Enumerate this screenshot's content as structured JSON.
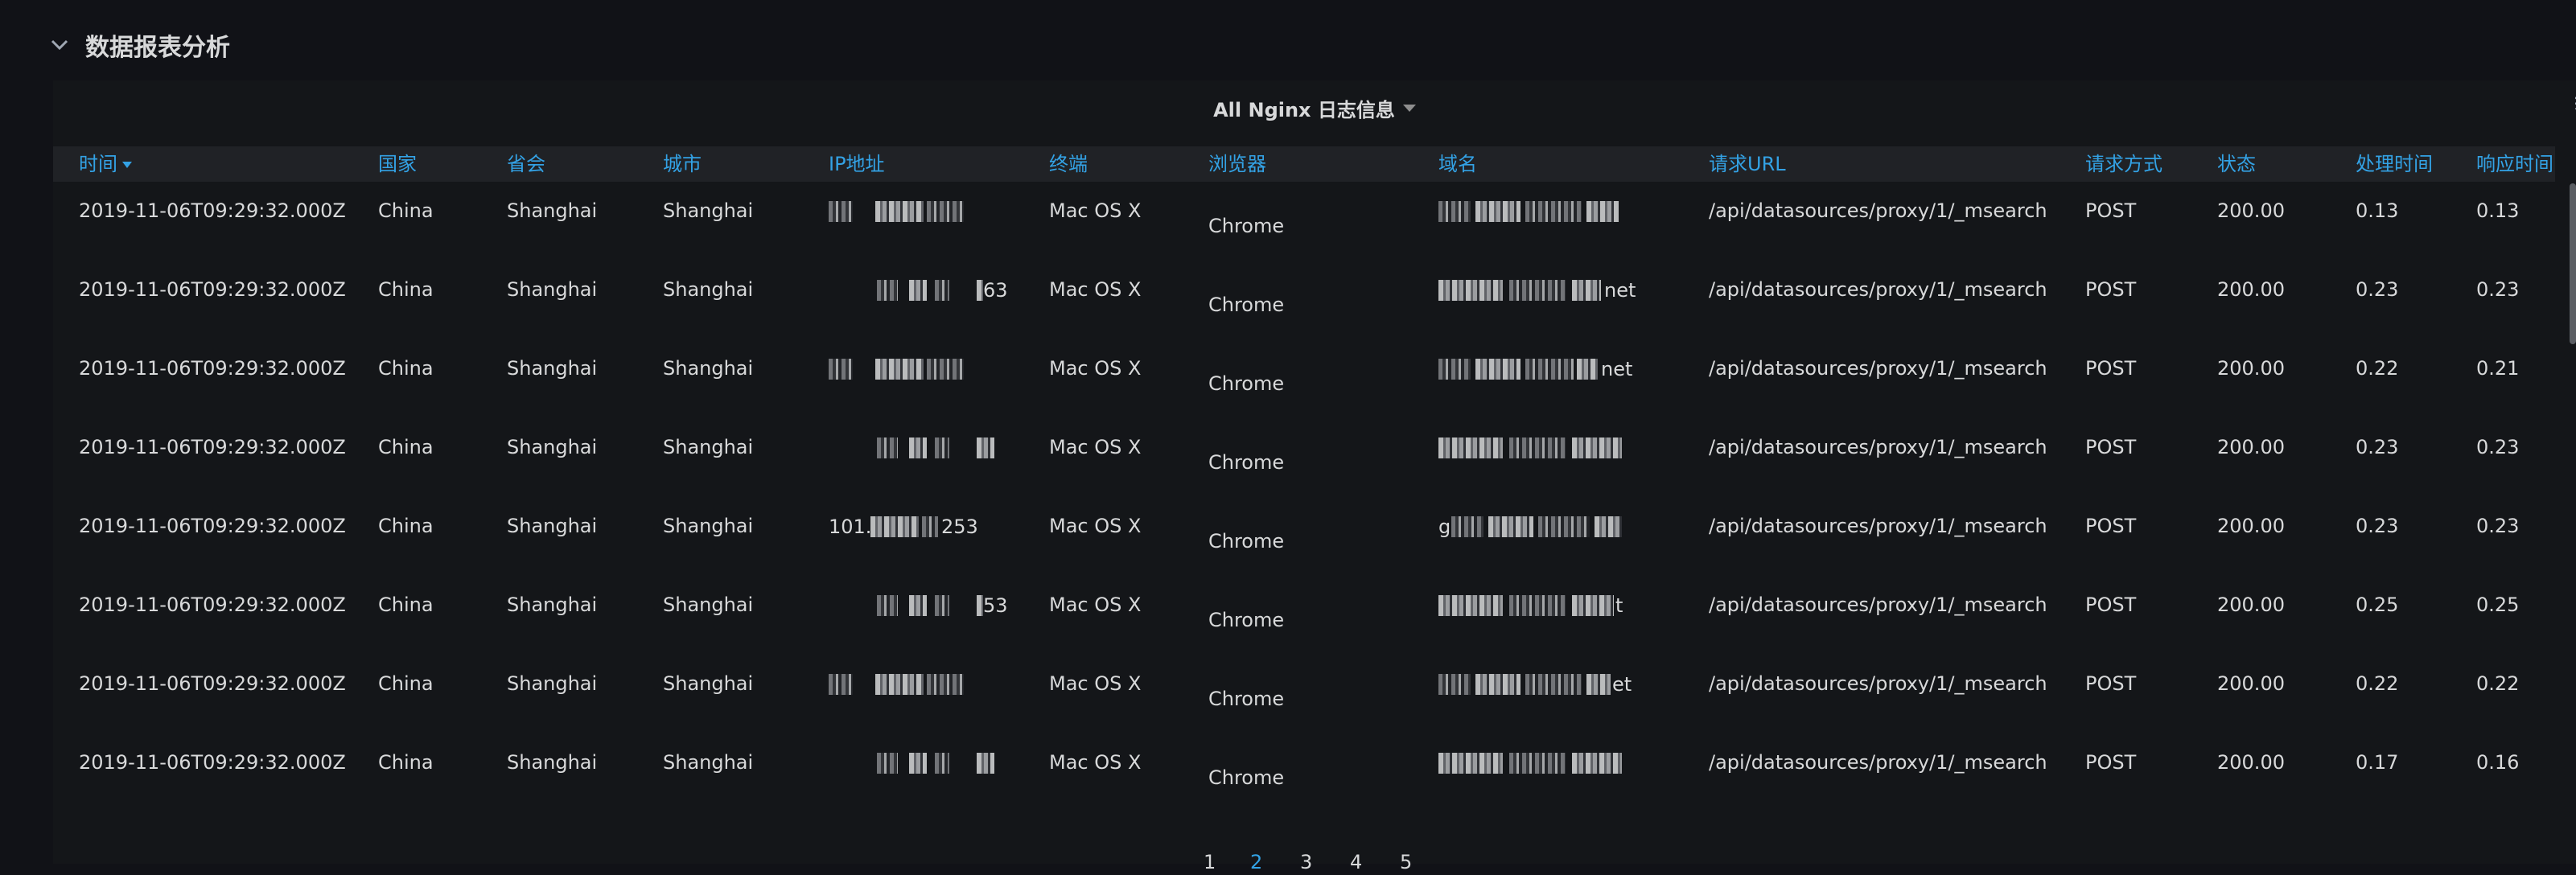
{
  "row": {
    "title": "数据报表分析"
  },
  "panel": {
    "title": "All Nginx 日志信息"
  },
  "columns": [
    "时间",
    "国家",
    "省会",
    "城市",
    "IP地址",
    "终端",
    "浏览器",
    "域名",
    "请求URL",
    "请求方式",
    "状态",
    "处理时间",
    "响应时间"
  ],
  "rows": [
    {
      "time": "2019-11-06T09:29:32.000Z",
      "country": "China",
      "province": "Shanghai",
      "city": "Shanghai",
      "ip_visible": "",
      "os": "Mac OS X",
      "browser": "Chrome",
      "domain_visible": "",
      "url": "/api/datasources/proxy/1/_msearch",
      "method": "POST",
      "status": "200.00",
      "process_time": "0.13",
      "response_time": "0.13"
    },
    {
      "time": "2019-11-06T09:29:32.000Z",
      "country": "China",
      "province": "Shanghai",
      "city": "Shanghai",
      "ip_visible": "63",
      "os": "Mac OS X",
      "browser": "Chrome",
      "domain_visible": "net",
      "url": "/api/datasources/proxy/1/_msearch",
      "method": "POST",
      "status": "200.00",
      "process_time": "0.23",
      "response_time": "0.23"
    },
    {
      "time": "2019-11-06T09:29:32.000Z",
      "country": "China",
      "province": "Shanghai",
      "city": "Shanghai",
      "ip_visible": "",
      "os": "Mac OS X",
      "browser": "Chrome",
      "domain_visible": "net",
      "url": "/api/datasources/proxy/1/_msearch",
      "method": "POST",
      "status": "200.00",
      "process_time": "0.22",
      "response_time": "0.21"
    },
    {
      "time": "2019-11-06T09:29:32.000Z",
      "country": "China",
      "province": "Shanghai",
      "city": "Shanghai",
      "ip_visible": "",
      "os": "Mac OS X",
      "browser": "Chrome",
      "domain_visible": "",
      "url": "/api/datasources/proxy/1/_msearch",
      "method": "POST",
      "status": "200.00",
      "process_time": "0.23",
      "response_time": "0.23"
    },
    {
      "time": "2019-11-06T09:29:32.000Z",
      "country": "China",
      "province": "Shanghai",
      "city": "Shanghai",
      "ip_visible": "101.",
      "ip_visible_end": "253",
      "os": "Mac OS X",
      "browser": "Chrome",
      "domain_visible": "g",
      "url": "/api/datasources/proxy/1/_msearch",
      "method": "POST",
      "status": "200.00",
      "process_time": "0.23",
      "response_time": "0.23"
    },
    {
      "time": "2019-11-06T09:29:32.000Z",
      "country": "China",
      "province": "Shanghai",
      "city": "Shanghai",
      "ip_visible": "53",
      "os": "Mac OS X",
      "browser": "Chrome",
      "domain_visible": "t",
      "url": "/api/datasources/proxy/1/_msearch",
      "method": "POST",
      "status": "200.00",
      "process_time": "0.25",
      "response_time": "0.25"
    },
    {
      "time": "2019-11-06T09:29:32.000Z",
      "country": "China",
      "province": "Shanghai",
      "city": "Shanghai",
      "ip_visible": "",
      "os": "Mac OS X",
      "browser": "Chrome",
      "domain_visible": "et",
      "url": "/api/datasources/proxy/1/_msearch",
      "method": "POST",
      "status": "200.00",
      "process_time": "0.22",
      "response_time": "0.22"
    },
    {
      "time": "2019-11-06T09:29:32.000Z",
      "country": "China",
      "province": "Shanghai",
      "city": "Shanghai",
      "ip_visible": "",
      "os": "Mac OS X",
      "browser": "Chrome",
      "domain_visible": "",
      "url": "/api/datasources/proxy/1/_msearch",
      "method": "POST",
      "status": "200.00",
      "process_time": "0.17",
      "response_time": "0.16"
    }
  ],
  "pagination": {
    "pages": [
      "1",
      "2",
      "3",
      "4",
      "5"
    ],
    "active": "2"
  },
  "colors": {
    "background": "#111217",
    "panel": "#141619",
    "header": "#202226",
    "accent": "#33a2e5",
    "text": "#d8d9da"
  },
  "icons": {
    "collapse": "chevron-down-icon",
    "panel_menu": "caret-down-icon",
    "sort": "sort-desc-icon"
  }
}
